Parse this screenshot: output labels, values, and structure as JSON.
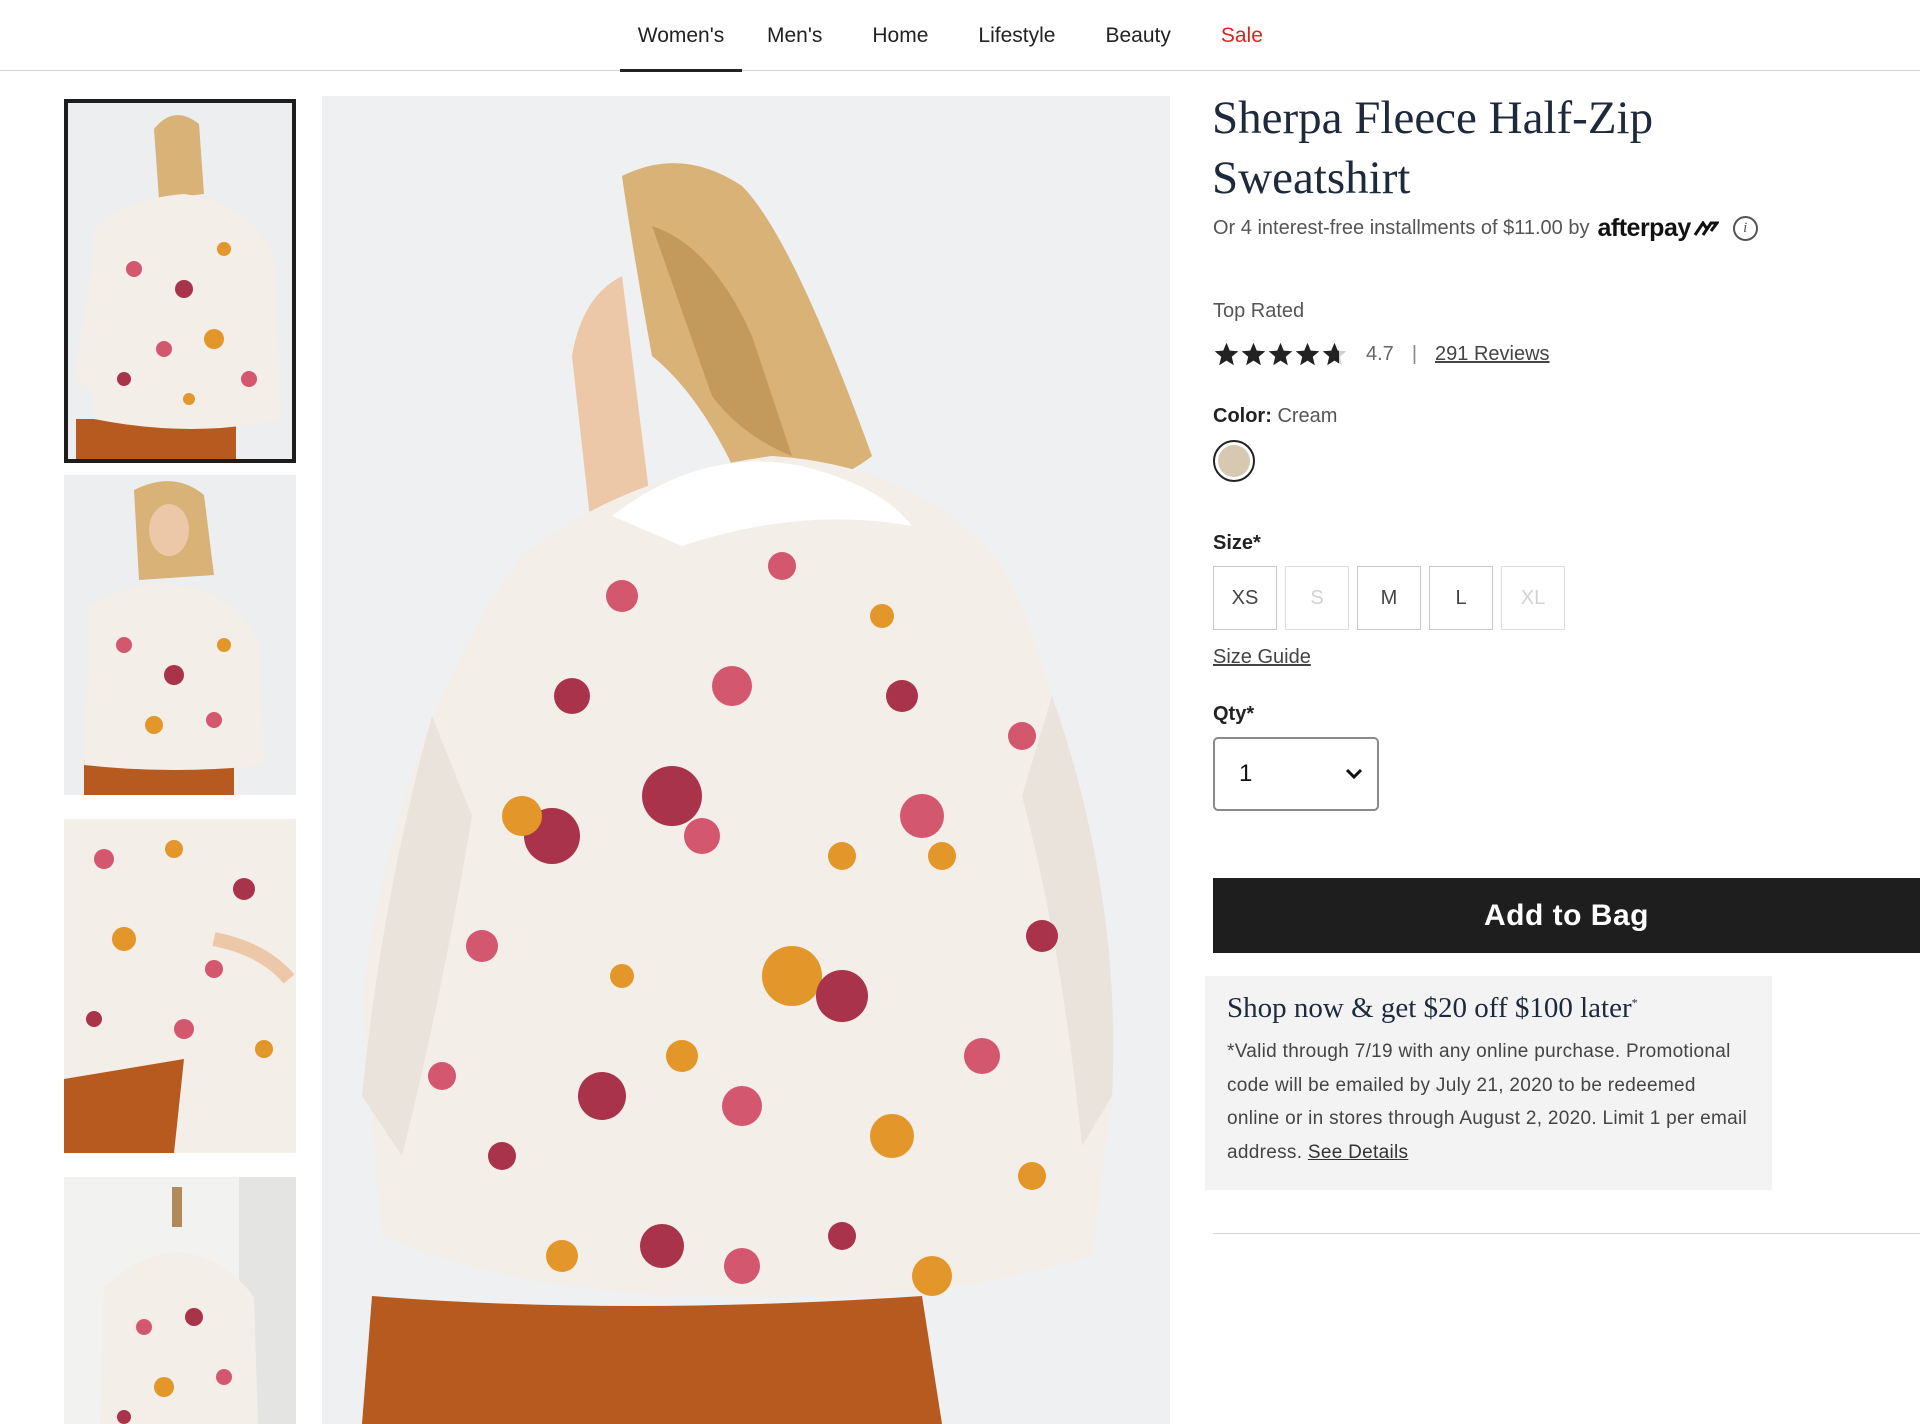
{
  "nav": {
    "items": [
      {
        "label": "Women's"
      },
      {
        "label": "Men's"
      },
      {
        "label": "Home"
      },
      {
        "label": "Lifestyle"
      },
      {
        "label": "Beauty"
      },
      {
        "label": "Sale"
      }
    ],
    "active_index": 0,
    "sale_color": "#e0201f"
  },
  "product": {
    "title": "Sherpa Fleece Half-Zip Sweatshirt",
    "afterpay_text": "Or 4 interest-free installments of $11.00 by",
    "afterpay_brand": "afterpay",
    "info_icon": "i",
    "top_rated": "Top Rated",
    "rating": "4.7",
    "rating_value": 4.7,
    "rating_max": 5,
    "rating_separator": "|",
    "reviews_label": "291 Reviews",
    "color_label": "Color:",
    "color_value": "Cream",
    "swatch_color": "#d7c8b2",
    "size_label": "Size*",
    "sizes": [
      {
        "label": "XS",
        "available": true
      },
      {
        "label": "S",
        "available": false
      },
      {
        "label": "M",
        "available": true
      },
      {
        "label": "L",
        "available": true
      },
      {
        "label": "XL",
        "available": false
      }
    ],
    "size_guide": "Size Guide",
    "qty_label": "Qty*",
    "qty_value": "1",
    "add_to_bag": "Add to Bag"
  },
  "promo": {
    "title": "Shop now & get $20 off $100 later",
    "title_mark": "*",
    "text": "*Valid through 7/19 with any online purchase. Promotional code will be emailed by July 21, 2020 to be redeemed online or in stores through August 2, 2020. Limit 1 per email address.",
    "link": "See Details"
  },
  "gallery": {
    "thumbnails": [
      "thumbnail-back-view",
      "thumbnail-front-view",
      "thumbnail-closeup-pocket",
      "thumbnail-mannequin"
    ],
    "selected_index": 0,
    "main_image": "main-image-back-view"
  },
  "colors": {
    "sweatshirt": "#f3eee8",
    "skirt": "#b75a1f",
    "hair": "#d8b277",
    "skin": "#ecc7a8",
    "flower_pink": "#d3576f",
    "flower_orange": "#e3962a",
    "flower_red": "#a8334a"
  }
}
